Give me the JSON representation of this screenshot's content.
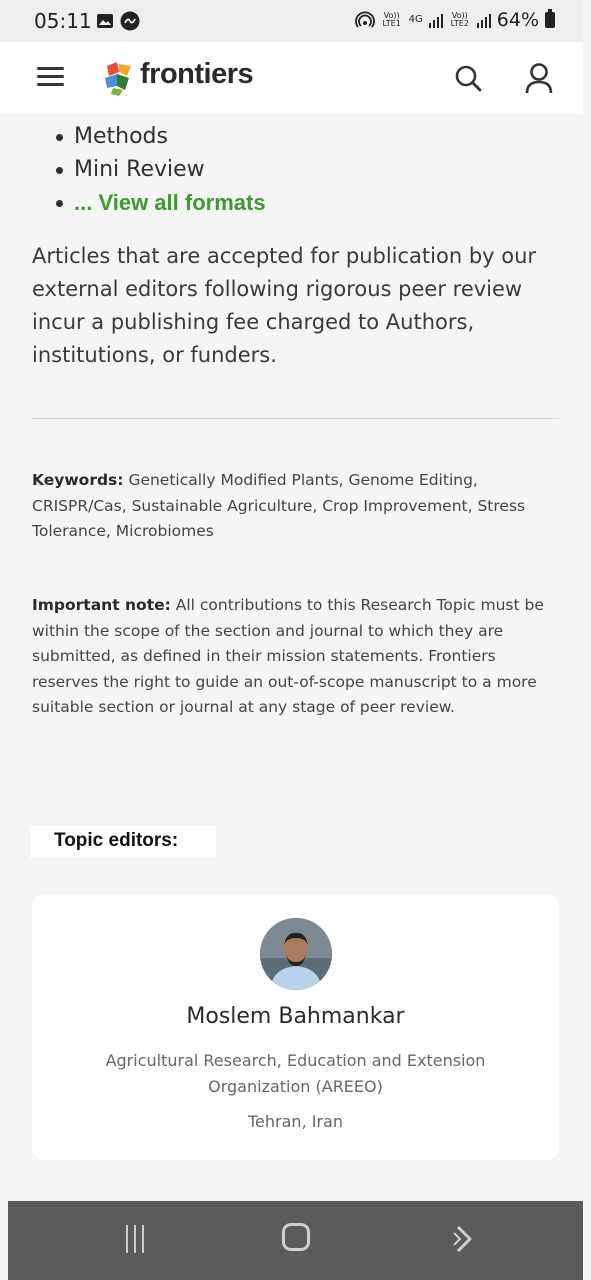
{
  "status_bar": {
    "time": "05:11",
    "network_labels": [
      "Vo)) LTE1",
      "4G",
      "Vo)) LTE2"
    ],
    "battery": "64%"
  },
  "header": {
    "logo_text": "frontiers",
    "icons": [
      "menu-icon",
      "frontiers-logo-mark",
      "search-icon",
      "user-icon"
    ]
  },
  "article_formats": {
    "items": [
      "Methods",
      "Mini Review"
    ],
    "view_all": "... View all formats"
  },
  "fee_paragraph": "Articles that are accepted for publication by our external editors following rigorous peer review incur a publishing fee charged to Authors, institutions, or funders.",
  "keywords": {
    "label": "Keywords:",
    "text": "Genetically Modified Plants, Genome Editing, CRISPR/Cas, Sustainable Agriculture, Crop Improvement, Stress Tolerance, Microbiomes"
  },
  "important_note": {
    "label": "Important note:",
    "text": "All contributions to this Research Topic must be within the scope of the section and journal to which they are submitted, as defined in their mission statements. Frontiers reserves the right to guide an out-of-scope manuscript to a more suitable section or journal at any stage of peer review."
  },
  "topic_editors": {
    "label": "Topic editors:",
    "editors": [
      {
        "name": "Moslem Bahmankar",
        "affiliation": "Agricultural Research, Education and Extension Organization (AREEO)",
        "location": "Tehran, Iran"
      }
    ]
  },
  "nav_bar": {
    "icons": [
      "recent-apps-icon",
      "home-icon",
      "back-icon"
    ]
  },
  "colors": {
    "link_green": "#3d9a2e",
    "background": "#f5f5f5",
    "nav_bar": "#5b5b5b"
  }
}
